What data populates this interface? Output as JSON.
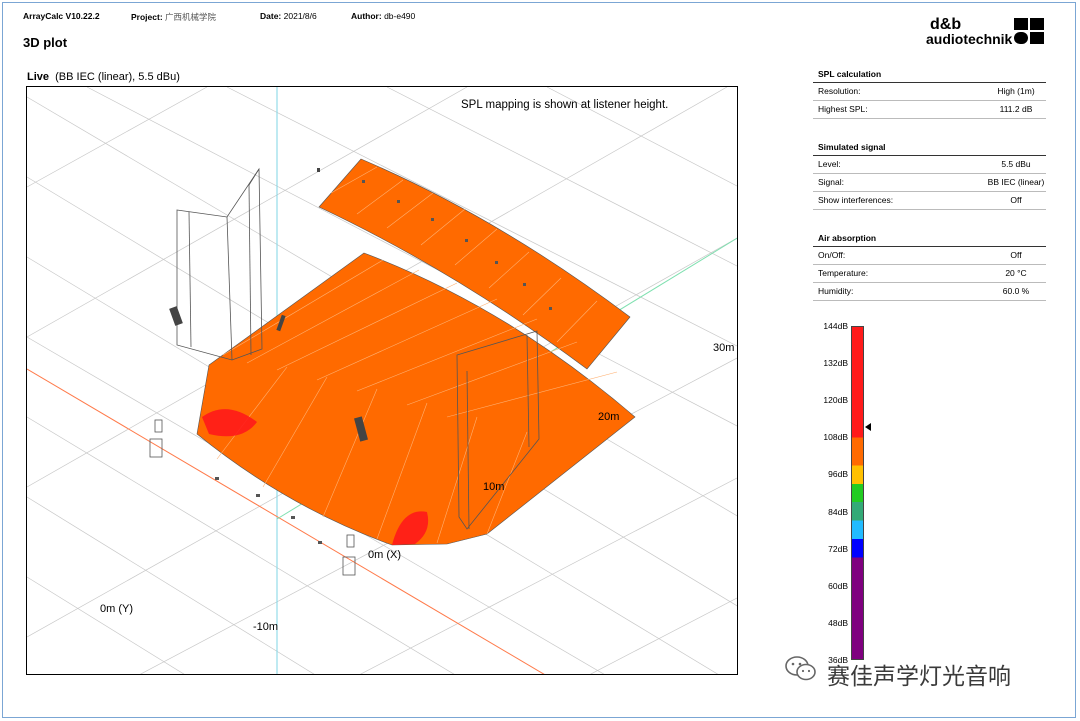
{
  "header": {
    "app_version": "ArrayCalc V10.22.2",
    "project_label": "Project:",
    "project_value": "广西机械学院",
    "date_label": "Date:",
    "date_value": "2021/8/6",
    "author_label": "Author:",
    "author_value": "db-e490"
  },
  "page_title": "3D plot",
  "logo": {
    "line1": "d&b",
    "line2": "audiotechnik"
  },
  "view": {
    "mode": "Live",
    "signal_info": "(BB IEC (linear), 5.5 dBu)",
    "note": "SPL mapping is shown at listener height.",
    "axis_labels": {
      "x_origin": "0m (X)",
      "y_origin": "0m (Y)",
      "neg10": "-10m",
      "m10": "10m",
      "m20": "20m",
      "m30": "30m"
    }
  },
  "spl_calculation": {
    "title": "SPL calculation",
    "rows": [
      {
        "label": "Resolution:",
        "value": "High (1m)"
      },
      {
        "label": "Highest SPL:",
        "value": "111.2 dB"
      }
    ]
  },
  "simulated_signal": {
    "title": "Simulated signal",
    "rows": [
      {
        "label": "Level:",
        "value": "5.5 dBu"
      },
      {
        "label": "Signal:",
        "value": "BB IEC (linear)"
      },
      {
        "label": "Show interferences:",
        "value": "Off"
      }
    ]
  },
  "air_absorption": {
    "title": "Air absorption",
    "rows": [
      {
        "label": "On/Off:",
        "value": "Off"
      },
      {
        "label": "Temperature:",
        "value": "20 °C"
      },
      {
        "label": "Humidity:",
        "value": "60.0 %"
      }
    ]
  },
  "color_scale": {
    "ticks": [
      "144dB",
      "132dB",
      "120dB",
      "108dB",
      "96dB",
      "84dB",
      "72dB",
      "60dB",
      "48dB",
      "36dB"
    ],
    "marker_value_db": 111.2,
    "colors": {
      "red": "#ff1a1a",
      "orange": "#ff6a00",
      "yellow": "#ffc000",
      "green": "#22cc22",
      "teal": "#33aa77",
      "cyan": "#22bbff",
      "blue": "#0000ff",
      "purple": "#7f007f"
    }
  },
  "watermark": "赛佳声学灯光音响"
}
